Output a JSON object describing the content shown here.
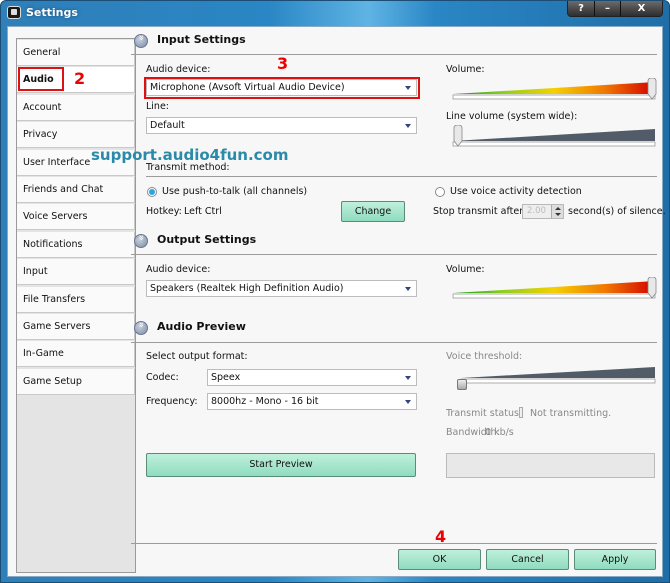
{
  "window": {
    "title": "Settings",
    "controls": {
      "help": "?",
      "minimize": "–",
      "close": "X"
    }
  },
  "sidebar": {
    "items": [
      {
        "label": "General",
        "active": false
      },
      {
        "label": "Audio",
        "active": true
      },
      {
        "label": "Account",
        "active": false
      },
      {
        "label": "Privacy",
        "active": false
      },
      {
        "label": "User Interface",
        "active": false
      },
      {
        "label": "Friends and Chat",
        "active": false
      },
      {
        "label": "Voice Servers",
        "active": false
      },
      {
        "label": "Notifications",
        "active": false
      },
      {
        "label": "Input",
        "active": false
      },
      {
        "label": "File Transfers",
        "active": false
      },
      {
        "label": "Game Servers",
        "active": false
      },
      {
        "label": "In-Game",
        "active": false
      },
      {
        "label": "Game Setup",
        "active": false
      }
    ]
  },
  "annotations": {
    "step2": "2",
    "step3": "3",
    "step4": "4",
    "watermark": "support.audio4fun.com"
  },
  "input_settings": {
    "title": "Input Settings",
    "audio_device_label": "Audio device:",
    "audio_device_value": "Microphone (Avsoft Virtual Audio Device)",
    "line_label": "Line:",
    "line_value": "Default",
    "volume_label": "Volume:",
    "volume_level": 1.0,
    "line_volume_label": "Line volume (system wide):",
    "line_volume_level": 0.0,
    "transmit_method_label": "Transmit method:",
    "push_to_talk_label": "Use push-to-talk (all channels)",
    "push_to_talk_selected": true,
    "hotkey_label": "Hotkey:",
    "hotkey_value": "Left Ctrl",
    "change_button": "Change",
    "voice_activity_label": "Use voice activity detection",
    "voice_activity_selected": false,
    "stop_transmit_label": "Stop transmit after:",
    "stop_transmit_value": "2.00",
    "stop_transmit_suffix": "second(s) of silence."
  },
  "output_settings": {
    "title": "Output Settings",
    "audio_device_label": "Audio device:",
    "audio_device_value": "Speakers (Realtek High Definition Audio)",
    "volume_label": "Volume:",
    "volume_level": 1.0
  },
  "audio_preview": {
    "title": "Audio Preview",
    "format_label": "Select output format:",
    "codec_label": "Codec:",
    "codec_value": "Speex",
    "frequency_label": "Frequency:",
    "frequency_value": "8000hz - Mono - 16 bit",
    "voice_threshold_label": "Voice threshold:",
    "voice_threshold_level": 0.02,
    "transmit_status_label": "Transmit status:",
    "transmit_status_value": "Not transmitting.",
    "bandwidth_label": "Bandwidth:",
    "bandwidth_value": "0 kb/s",
    "start_preview_button": "Start Preview"
  },
  "footer": {
    "ok": "OK",
    "cancel": "Cancel",
    "apply": "Apply"
  }
}
